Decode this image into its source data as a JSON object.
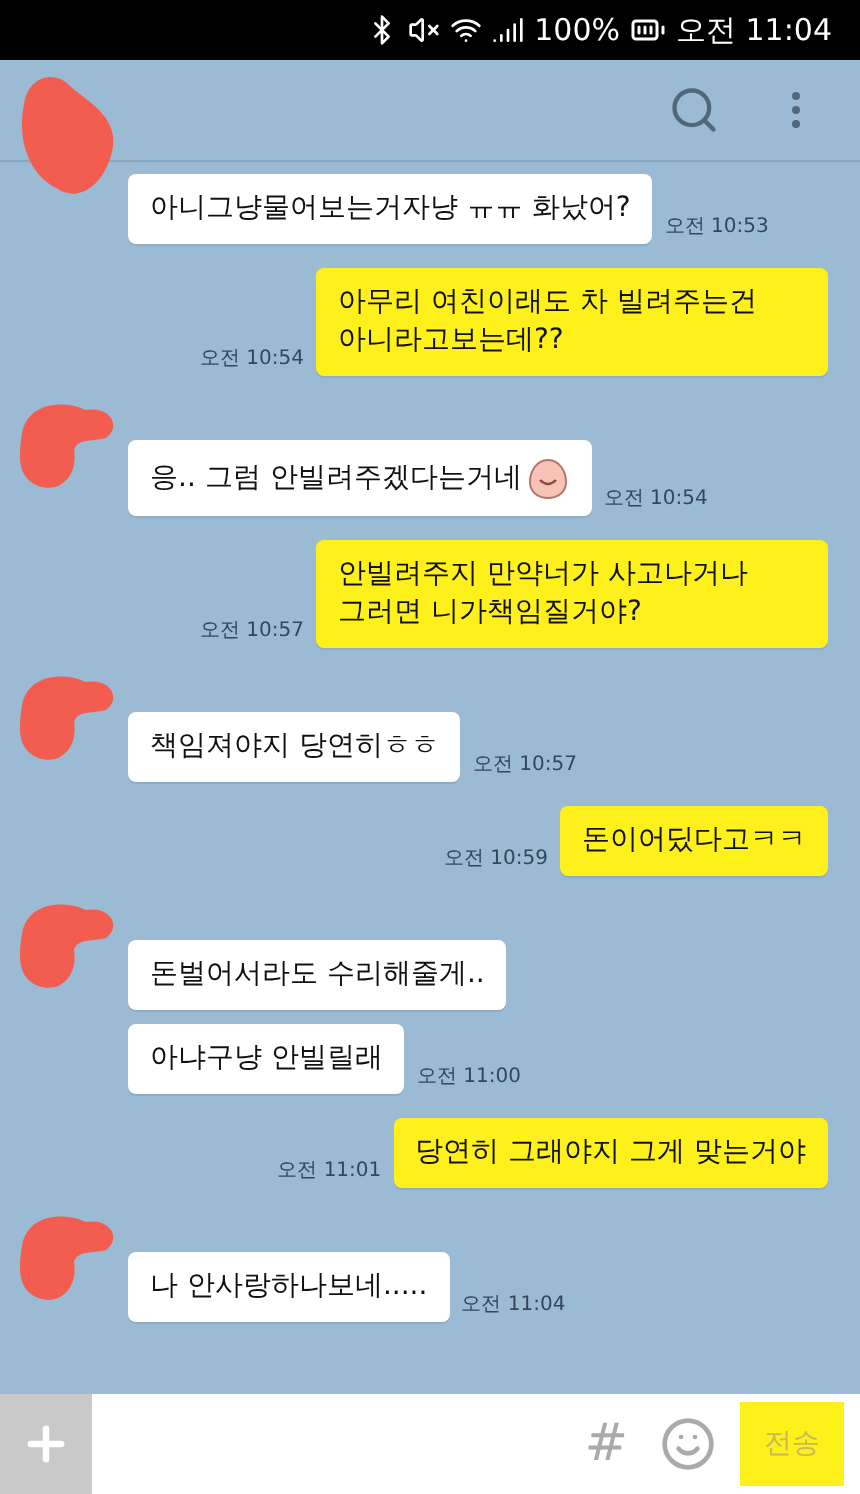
{
  "status_bar": {
    "battery": "100%",
    "time": "오전 11:04"
  },
  "messages": [
    {
      "kind": "received",
      "text": "아니그냥물어보는거자냥 ㅠㅠ 화났어?",
      "time": "오전 10:53",
      "emoticon": false
    },
    {
      "kind": "sent",
      "text": "아무리 여친이래도 차 빌려주는건 아니라고보는데??",
      "time": "오전 10:54"
    },
    {
      "kind": "received",
      "avatar": true,
      "text": "응.. 그럼 안빌려주겠다는거네",
      "time": "오전 10:54",
      "emoticon": true
    },
    {
      "kind": "sent",
      "text": "안빌려주지 만약너가 사고나거나 그러면 니가책임질거야?",
      "time": "오전 10:57"
    },
    {
      "kind": "received",
      "avatar": true,
      "text": "책임져야지 당연히ㅎㅎ",
      "time": "오전 10:57",
      "emoticon": false
    },
    {
      "kind": "sent",
      "text": "돈이어딨다고ㅋㅋ",
      "time": "오전 10:59"
    },
    {
      "kind": "received",
      "avatar": true,
      "text": "돈벌어서라도 수리해줄게..",
      "emoticon": false
    },
    {
      "kind": "received",
      "avatar": false,
      "text": "아냐구냥 안빌릴래",
      "time": "오전 11:00",
      "emoticon": false
    },
    {
      "kind": "sent",
      "text": "당연히 그래야지 그게 맞는거야",
      "time": "오전 11:01"
    },
    {
      "kind": "received",
      "avatar": true,
      "text": "나 안사랑하나보네.....",
      "time": "오전 11:04",
      "emoticon": false
    }
  ],
  "input_bar": {
    "hash": "#",
    "send_label": "전송"
  }
}
